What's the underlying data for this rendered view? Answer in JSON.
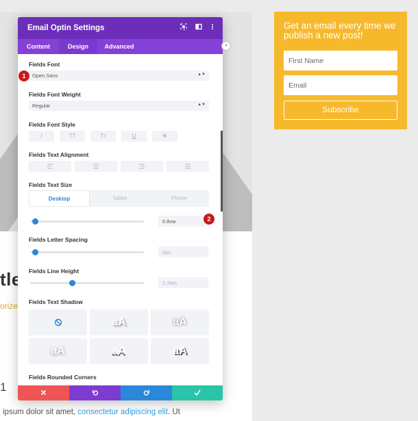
{
  "background": {
    "title_fragment": "tle",
    "category_fragment": "orized",
    "number_fragment": "1",
    "lorem_prefix": "ipsum dolor sit amet, ",
    "lorem_link": "consectetur adipiscing elit",
    "lorem_suffix": ". Ut"
  },
  "optin": {
    "title": "Get an email every time we publish a new post!",
    "first_name_placeholder": "First Name",
    "email_placeholder": "Email",
    "subscribe_label": "Subscribe"
  },
  "modal": {
    "title": "Email Optin Settings",
    "header_icons": [
      "fullscreen-icon",
      "split-view-icon",
      "more-icon"
    ],
    "tabs": [
      {
        "label": "Content",
        "active": false
      },
      {
        "label": "Design",
        "active": true
      },
      {
        "label": "Advanced",
        "active": false
      }
    ],
    "fields_font": {
      "label": "Fields Font",
      "value": "Open Sans"
    },
    "fields_font_weight": {
      "label": "Fields Font Weight",
      "value": "Regular"
    },
    "fields_font_style": {
      "label": "Fields Font Style",
      "buttons": [
        "I",
        "TT",
        "Tт",
        "U",
        "S"
      ]
    },
    "fields_text_alignment": {
      "label": "Fields Text Alignment"
    },
    "fields_text_size": {
      "label": "Fields Text Size",
      "devices": [
        "Desktop",
        "Tablet",
        "Phone"
      ],
      "active_device": "Desktop",
      "value": "0.8vw",
      "slider_fraction": 0.02
    },
    "fields_letter_spacing": {
      "label": "Fields Letter Spacing",
      "value": "0px",
      "slider_fraction": 0.02
    },
    "fields_line_height": {
      "label": "Fields Line Height",
      "value": "1.7em",
      "slider_fraction": 0.36
    },
    "fields_text_shadow": {
      "label": "Fields Text Shadow",
      "preview_text": "aA"
    },
    "fields_rounded_corners": {
      "label": "Fields Rounded Corners"
    }
  },
  "footer": {
    "colors": {
      "cancel": "#ef5555",
      "undo": "#7e3bd0",
      "redo": "#2b87da",
      "save": "#29c4a9"
    }
  },
  "badges": {
    "one": "1",
    "two": "2"
  },
  "accent": "#2b87da"
}
